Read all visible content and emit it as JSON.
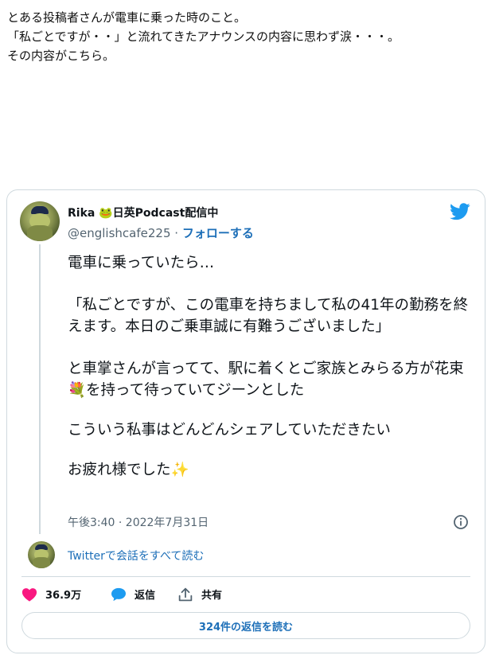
{
  "intro": {
    "line1": "とある投稿者さんが電車に乗った時のこと。",
    "line2": "「私ごとですが・・」と流れてきたアナウンスの内容に思わず涙・・・。",
    "line3": "その内容がこちら。"
  },
  "tweet": {
    "author_name": "Rika",
    "author_emoji": "🐸",
    "author_suffix": "日英Podcast配信中",
    "handle": "@englishcafe225",
    "separator": " · ",
    "follow_label": "フォローする",
    "text": {
      "p1": "電車に乗っていたら…",
      "p2": "「私ごとですが、この電車を持ちまして私の41年の勤務を終えます。本日のご乗車誠に有難うございました」",
      "p3_before": "と車掌さんが言ってて、駅に着くとご家族とみらる方が花束",
      "p3_emoji": "💐",
      "p3_after": "を持って待っていてジーンとした",
      "p4": "こういう私事はどんどんシェアしていただきたい",
      "p5": "お疲れ様でした",
      "p5_emoji": "✨"
    },
    "timestamp": "午後3:40 · 2022年7月31日",
    "read_conversation": "Twitterで会話をすべて読む",
    "like_count": "36.9万",
    "reply_label": "返信",
    "share_label": "共有",
    "read_replies": "324件の返信を読む"
  },
  "colors": {
    "accent": "#1d9bf0",
    "link": "#1d6fb8",
    "like": "#f91880",
    "muted": "#536471",
    "border": "#cfd9de"
  },
  "icons": [
    "twitter-bird-icon",
    "info-icon",
    "heart-icon",
    "reply-bubble-icon",
    "share-icon"
  ]
}
